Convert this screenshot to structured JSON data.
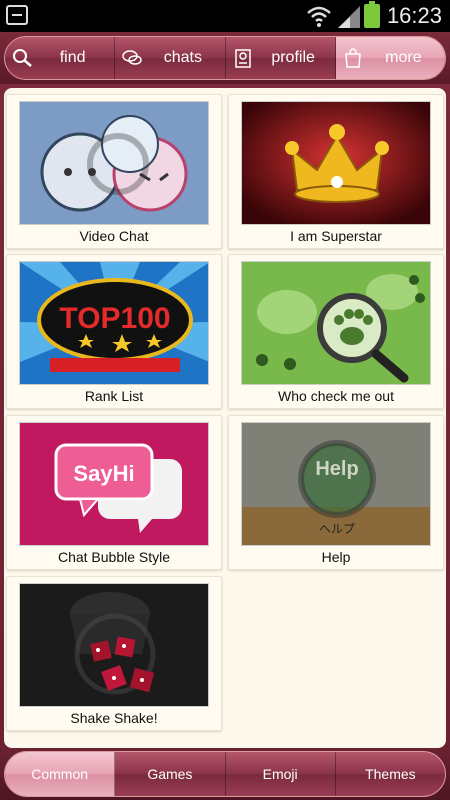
{
  "status_bar": {
    "time": "16:23"
  },
  "top_nav": {
    "items": [
      {
        "label": "find",
        "icon": "search-icon"
      },
      {
        "label": "chats",
        "icon": "chat-bubbles-icon"
      },
      {
        "label": "profile",
        "icon": "profile-card-icon"
      },
      {
        "label": "more",
        "icon": "shopping-bag-icon",
        "active": true
      }
    ]
  },
  "tiles": [
    {
      "label": "Video Chat",
      "icon": "video-chat-icon"
    },
    {
      "label": "I am Superstar",
      "icon": "crown-icon"
    },
    {
      "label": "Rank List",
      "icon": "top100-icon",
      "thumb_text": "TOP100"
    },
    {
      "label": "Who check me out",
      "icon": "paw-magnifier-icon"
    },
    {
      "label": "Chat Bubble Style",
      "icon": "sayhi-bubble-icon",
      "thumb_text": "SayHi"
    },
    {
      "label": "Help",
      "icon": "help-icon",
      "thumb_text": "Help",
      "thumb_subtext": "ヘルプ"
    },
    {
      "label": "Shake Shake!",
      "icon": "dice-icon"
    }
  ],
  "bottom_tabs": {
    "items": [
      {
        "label": "Common",
        "active": true
      },
      {
        "label": "Games"
      },
      {
        "label": "Emoji"
      },
      {
        "label": "Themes"
      }
    ]
  },
  "colors": {
    "accent": "#8a3349",
    "active_tab": "#e7a4b4",
    "panel_bg": "#fdf8ec"
  }
}
